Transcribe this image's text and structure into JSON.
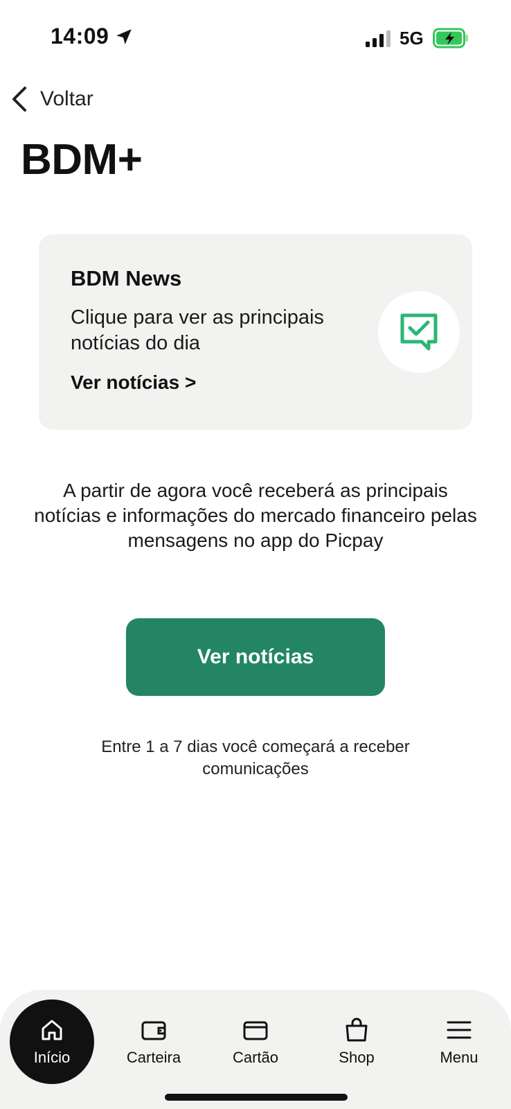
{
  "status_bar": {
    "time": "14:09",
    "network": "5G",
    "battery_color": "#34c759"
  },
  "header": {
    "back_label": "Voltar",
    "title": "BDM+"
  },
  "card": {
    "title": "BDM News",
    "description": "Clique para ver as principais notícias do dia",
    "link_label": "Ver notícias >",
    "icon": "message-check-icon",
    "accent": "#2bb673"
  },
  "info_text": "A partir de agora você receberá as principais notícias e informações do mercado financeiro pelas mensagens no app do Picpay",
  "cta": {
    "label": "Ver notícias",
    "color": "#238563"
  },
  "note": "Entre 1 a 7 dias você começará a receber comunicações",
  "bottom_nav": {
    "items": [
      {
        "label": "Início",
        "icon": "home-icon",
        "active": true
      },
      {
        "label": "Carteira",
        "icon": "wallet-icon"
      },
      {
        "label": "Cartão",
        "icon": "card-icon"
      },
      {
        "label": "Shop",
        "icon": "shopping-bag-icon"
      },
      {
        "label": "Menu",
        "icon": "menu-icon"
      }
    ]
  }
}
